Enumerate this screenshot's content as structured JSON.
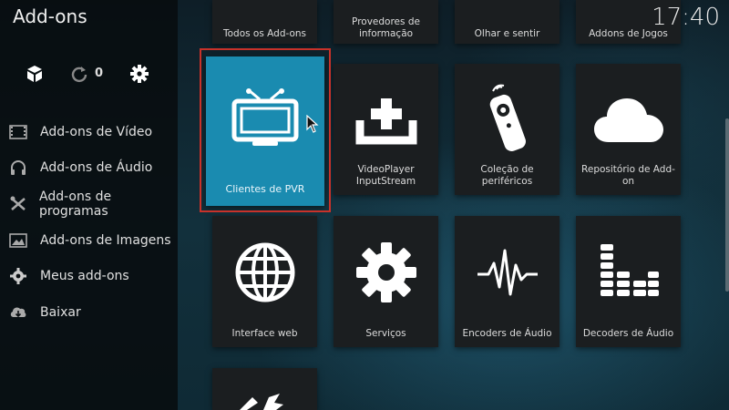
{
  "app": {
    "title": "Add-ons",
    "clock": "17:40"
  },
  "top_icons": {
    "update_count": "0"
  },
  "sidebar": {
    "items": [
      {
        "label": "Add-ons de Vídeo",
        "icon": "film-icon"
      },
      {
        "label": "Add-ons de Áudio",
        "icon": "headphones-icon"
      },
      {
        "label": "Add-ons de programas",
        "icon": "tools-icon"
      },
      {
        "label": "Add-ons de Imagens",
        "icon": "image-icon"
      },
      {
        "label": "Meus add-ons",
        "icon": "gear-icon"
      },
      {
        "label": "Baixar",
        "icon": "cloud-download-icon"
      }
    ]
  },
  "top_row": [
    {
      "label": "Todos os Add-ons"
    },
    {
      "label": "Provedores de informação"
    },
    {
      "label": "Olhar e sentir"
    },
    {
      "label": "Addons de Jogos"
    }
  ],
  "tiles": [
    {
      "label": "Clientes de PVR",
      "icon": "tv-icon",
      "focused": true
    },
    {
      "label": "VideoPlayer InputStream",
      "icon": "inbox-add-icon"
    },
    {
      "label": "Coleção de periféricos",
      "icon": "remote-control-icon"
    },
    {
      "label": "Repositório de Add-on",
      "icon": "cloud-icon"
    },
    {
      "label": "Interface web",
      "icon": "globe-icon"
    },
    {
      "label": "Serviços",
      "icon": "gear-icon"
    },
    {
      "label": "Encoders de Áudio",
      "icon": "waveform-icon"
    },
    {
      "label": "Decoders de Áudio",
      "icon": "equalizer-icon"
    }
  ],
  "colors": {
    "focus_tile": "#1a8bb0",
    "focus_border": "#c8322a",
    "tile_bg": "#1b1e20"
  }
}
